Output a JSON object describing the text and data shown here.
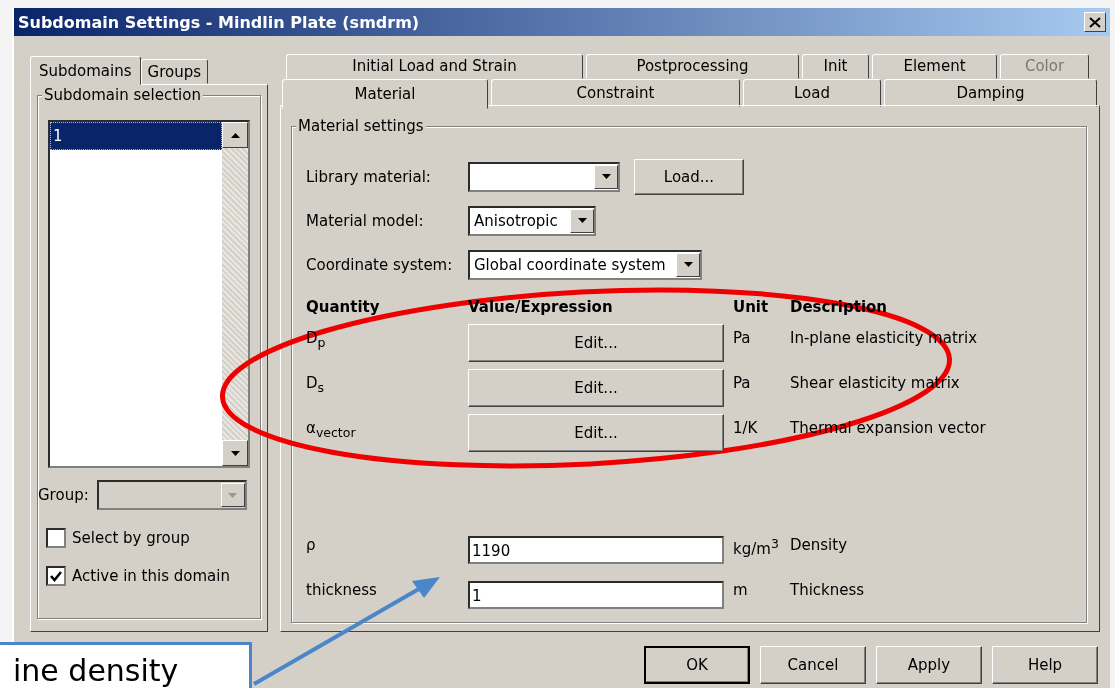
{
  "window": {
    "title": "Subdomain Settings - Mindlin Plate (smdrm)"
  },
  "left_tabs": [
    {
      "label": "Subdomains",
      "selected": true
    },
    {
      "label": "Groups",
      "selected": false
    }
  ],
  "subdomain_selection": {
    "title": "Subdomain selection",
    "items": [
      {
        "label": "1",
        "selected": true
      }
    ],
    "group": {
      "label": "Group:",
      "disabled": true
    },
    "checkboxes": [
      {
        "label": "Select by group",
        "checked": false
      },
      {
        "label": "Active in this domain",
        "checked": true
      }
    ]
  },
  "tab_rows": [
    [
      {
        "label": "Initial Load and Strain",
        "selected": false,
        "disabled": false
      },
      {
        "label": "Postprocessing",
        "selected": false,
        "disabled": false
      },
      {
        "label": "Init",
        "selected": false,
        "disabled": false
      },
      {
        "label": "Element",
        "selected": false,
        "disabled": false
      },
      {
        "label": "Color",
        "selected": false,
        "disabled": true
      }
    ],
    [
      {
        "label": "Material",
        "selected": true,
        "disabled": false
      },
      {
        "label": "Constraint",
        "selected": false,
        "disabled": false
      },
      {
        "label": "Load",
        "selected": false,
        "disabled": false
      },
      {
        "label": "Damping",
        "selected": false,
        "disabled": false
      }
    ]
  ],
  "material_settings": {
    "title": "Material settings",
    "library_material": {
      "label": "Library material:",
      "button": "Load..."
    },
    "material_model": {
      "label": "Material model:",
      "value": "Anisotropic"
    },
    "coordinate_system": {
      "label": "Coordinate system:",
      "value": "Global coordinate system"
    },
    "columns": [
      "Quantity",
      "Value/Expression",
      "Unit",
      "Description"
    ],
    "rows": [
      {
        "kind": "button",
        "quantity": "D$_{p}$",
        "value": "Edit...",
        "unit": "Pa",
        "description": "In-plane elasticity matrix"
      },
      {
        "kind": "button",
        "quantity": "D$_{s}$",
        "value": "Edit...",
        "unit": "Pa",
        "description": "Shear elasticity matrix"
      },
      {
        "kind": "button",
        "quantity": "α$_{vector}$",
        "value": "Edit...",
        "unit": "1/K",
        "description": "Thermal expansion vector"
      },
      {
        "kind": "field",
        "quantity": "ρ",
        "value": "1190",
        "unit": "kg/m$^{3}$",
        "description": "Density"
      },
      {
        "kind": "field",
        "quantity": "thickness",
        "value": "1",
        "unit": "m",
        "description": "Thickness"
      }
    ]
  },
  "buttons": [
    "OK",
    "Cancel",
    "Apply",
    "Help"
  ],
  "callout": {
    "text": "ine density"
  }
}
